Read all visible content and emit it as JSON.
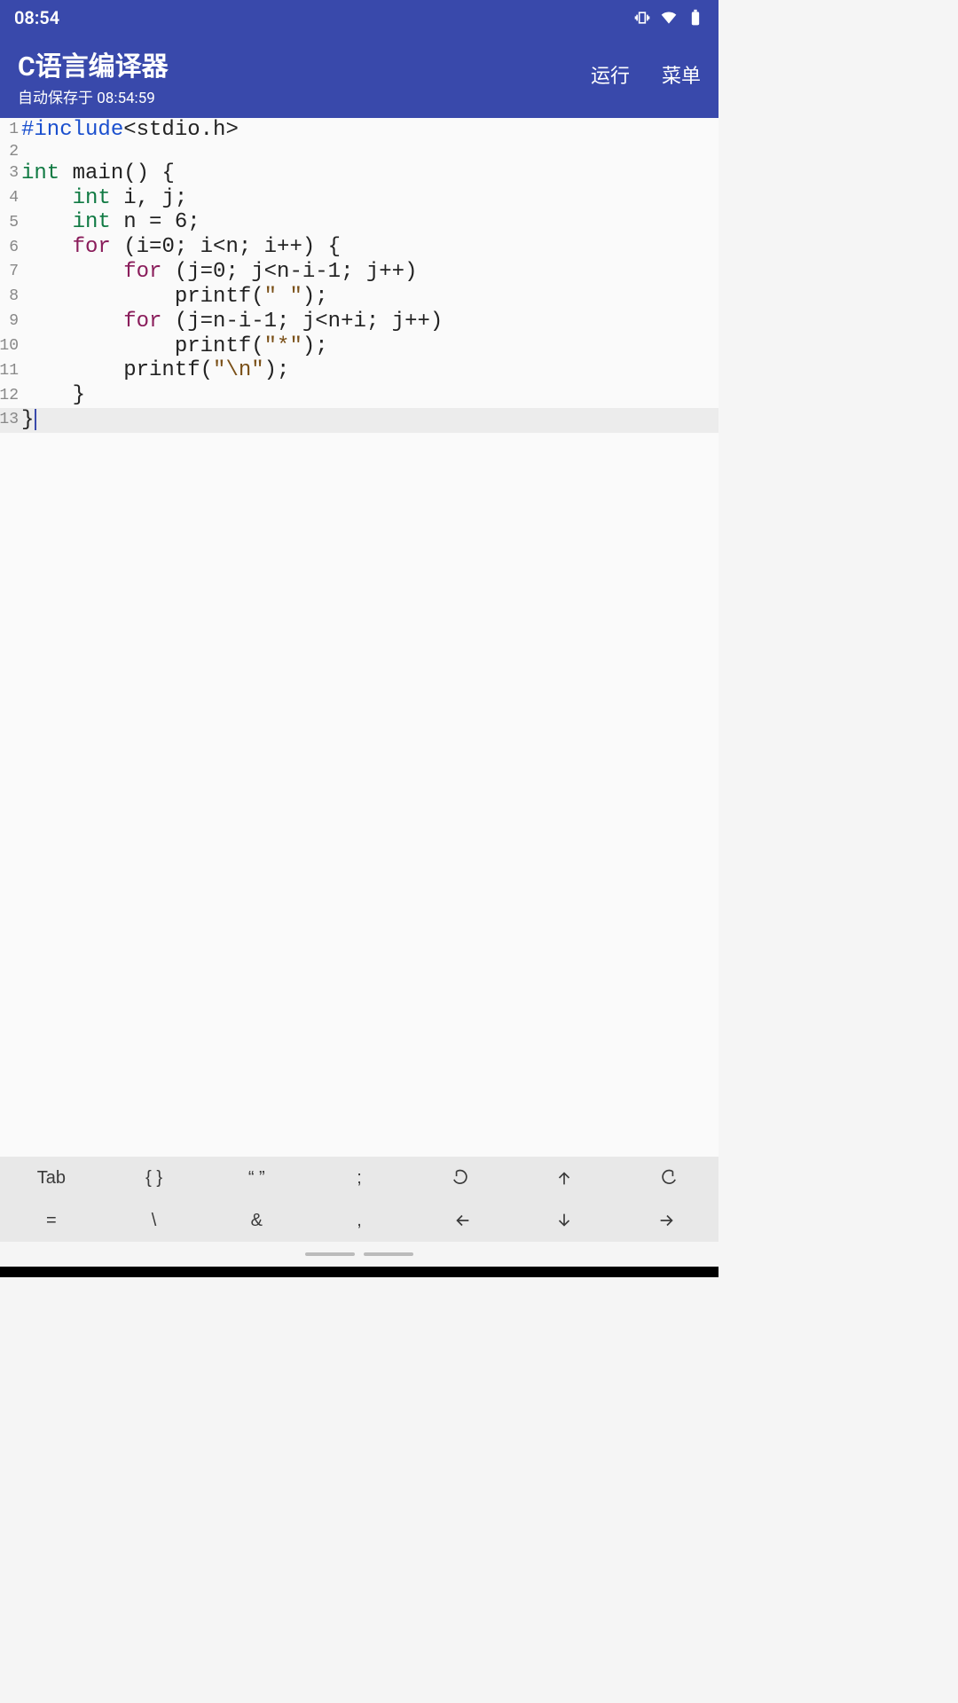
{
  "status": {
    "time": "08:54",
    "icons": [
      "vibrate-icon",
      "wifi-icon",
      "battery-icon"
    ]
  },
  "appbar": {
    "title": "C语言编译器",
    "subtitle": "自动保存于 08:54:59",
    "run_label": "运行",
    "menu_label": "菜单"
  },
  "editor": {
    "cursor_line": 13,
    "lines": [
      {
        "n": 1,
        "tokens": [
          {
            "cls": "tok-pp",
            "t": "#include"
          },
          {
            "cls": "",
            "t": "<stdio.h>"
          }
        ]
      },
      {
        "n": 2,
        "tokens": []
      },
      {
        "n": 3,
        "tokens": [
          {
            "cls": "tok-kw",
            "t": "int"
          },
          {
            "cls": "",
            "t": " main() {"
          }
        ]
      },
      {
        "n": 4,
        "tokens": [
          {
            "cls": "",
            "t": "    "
          },
          {
            "cls": "tok-kw",
            "t": "int"
          },
          {
            "cls": "",
            "t": " i, j;"
          }
        ]
      },
      {
        "n": 5,
        "tokens": [
          {
            "cls": "",
            "t": "    "
          },
          {
            "cls": "tok-kw",
            "t": "int"
          },
          {
            "cls": "",
            "t": " n = 6;"
          }
        ]
      },
      {
        "n": 6,
        "tokens": [
          {
            "cls": "",
            "t": "    "
          },
          {
            "cls": "tok-ctrl",
            "t": "for"
          },
          {
            "cls": "",
            "t": " (i=0; i<n; i++) {"
          }
        ]
      },
      {
        "n": 7,
        "tokens": [
          {
            "cls": "",
            "t": "        "
          },
          {
            "cls": "tok-ctrl",
            "t": "for"
          },
          {
            "cls": "",
            "t": " (j=0; j<n-i-1; j++)"
          }
        ]
      },
      {
        "n": 8,
        "tokens": [
          {
            "cls": "",
            "t": "            printf("
          },
          {
            "cls": "tok-str",
            "t": "\" \""
          },
          {
            "cls": "",
            "t": ");"
          }
        ]
      },
      {
        "n": 9,
        "tokens": [
          {
            "cls": "",
            "t": "        "
          },
          {
            "cls": "tok-ctrl",
            "t": "for"
          },
          {
            "cls": "",
            "t": " (j=n-i-1; j<n+i; j++)"
          }
        ]
      },
      {
        "n": 10,
        "tokens": [
          {
            "cls": "",
            "t": "            printf("
          },
          {
            "cls": "tok-str",
            "t": "\"*\""
          },
          {
            "cls": "",
            "t": ");"
          }
        ]
      },
      {
        "n": 11,
        "tokens": [
          {
            "cls": "",
            "t": "        printf("
          },
          {
            "cls": "tok-str",
            "t": "\"\\n\""
          },
          {
            "cls": "",
            "t": ");"
          }
        ]
      },
      {
        "n": 12,
        "tokens": [
          {
            "cls": "",
            "t": "    }"
          }
        ]
      },
      {
        "n": 13,
        "tokens": [
          {
            "cls": "",
            "t": "}"
          }
        ]
      }
    ]
  },
  "toolbar": {
    "row1": [
      {
        "key": "tab",
        "label": "Tab"
      },
      {
        "key": "braces",
        "label": "{ }"
      },
      {
        "key": "quotes",
        "label": "“ ”"
      },
      {
        "key": "semicolon",
        "label": ";"
      },
      {
        "key": "undo",
        "icon": "undo"
      },
      {
        "key": "up",
        "icon": "arrow-up"
      },
      {
        "key": "redo",
        "icon": "redo"
      }
    ],
    "row2": [
      {
        "key": "equals",
        "label": "="
      },
      {
        "key": "backslash",
        "label": "\\"
      },
      {
        "key": "ampersand",
        "label": "&"
      },
      {
        "key": "comma",
        "label": ","
      },
      {
        "key": "left",
        "icon": "arrow-left"
      },
      {
        "key": "down",
        "icon": "arrow-down"
      },
      {
        "key": "right",
        "icon": "arrow-right"
      }
    ]
  }
}
